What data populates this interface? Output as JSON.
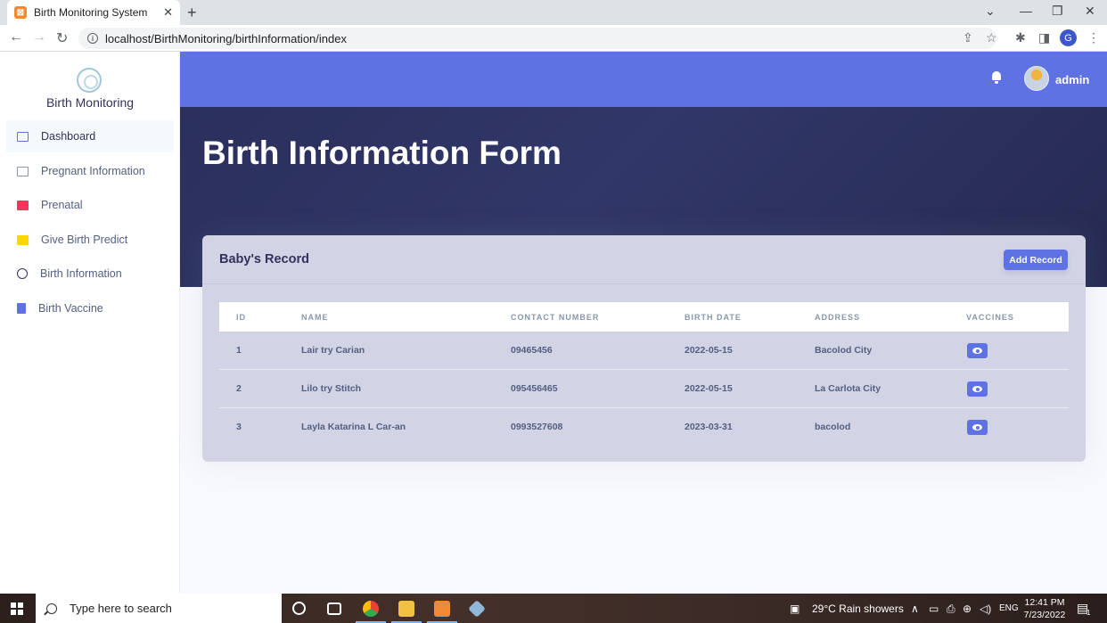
{
  "browser": {
    "tab_title": "Birth Monitoring System",
    "url": "localhost/BirthMonitoring/birthInformation/index",
    "profile_initial": "G"
  },
  "sidebar": {
    "brand": "Birth Monitoring",
    "items": [
      {
        "label": "Dashboard",
        "icon": "monitor-icon",
        "active": true
      },
      {
        "label": "Pregnant Information",
        "icon": "monitor-icon"
      },
      {
        "label": "Prenatal",
        "icon": "red-box-icon"
      },
      {
        "label": "Give Birth Predict",
        "icon": "calendar-icon"
      },
      {
        "label": "Birth Information",
        "icon": "globe-icon"
      },
      {
        "label": "Birth Vaccine",
        "icon": "document-icon"
      }
    ]
  },
  "topnav": {
    "username": "admin"
  },
  "hero": {
    "title": "Birth Information Form"
  },
  "card": {
    "title": "Baby's Record",
    "add_button": "Add Record"
  },
  "table": {
    "headers": [
      "ID",
      "NAME",
      "CONTACT NUMBER",
      "BIRTH DATE",
      "ADDRESS",
      "VACCINES"
    ],
    "rows": [
      {
        "id": "1",
        "name": "Lair try Carian",
        "contact": "09465456",
        "birth_date": "2022-05-15",
        "address": "Bacolod City"
      },
      {
        "id": "2",
        "name": "Lilo try Stitch",
        "contact": "095456465",
        "birth_date": "2022-05-15",
        "address": "La Carlota City"
      },
      {
        "id": "3",
        "name": "Layla Katarina L Car-an",
        "contact": "0993527608",
        "birth_date": "2023-03-31",
        "address": "bacolod"
      }
    ]
  },
  "taskbar": {
    "search_placeholder": "Type here to search",
    "weather": "29°C  Rain showers",
    "language": "ENG",
    "time": "12:41 PM",
    "date": "7/23/2022",
    "notification_count": "1"
  },
  "colors": {
    "primary": "#5e72e4",
    "hero": "#2a2f5c",
    "card": "#d3d3e6"
  }
}
